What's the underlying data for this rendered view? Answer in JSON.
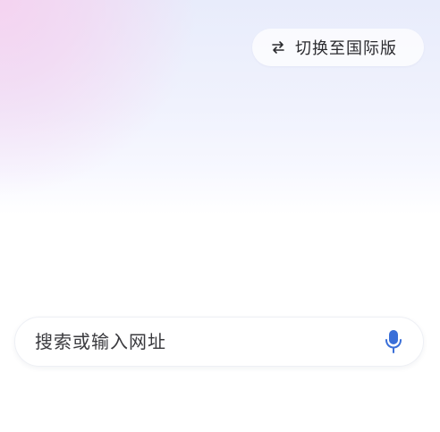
{
  "header": {
    "switch_label": "切换至国际版",
    "switch_icon": "swap-arrows-icon"
  },
  "search": {
    "placeholder": "搜索或输入网址",
    "value": "",
    "mic_icon": "microphone-icon"
  },
  "colors": {
    "accent": "#3a6fd8",
    "text": "#2b2b2f"
  }
}
